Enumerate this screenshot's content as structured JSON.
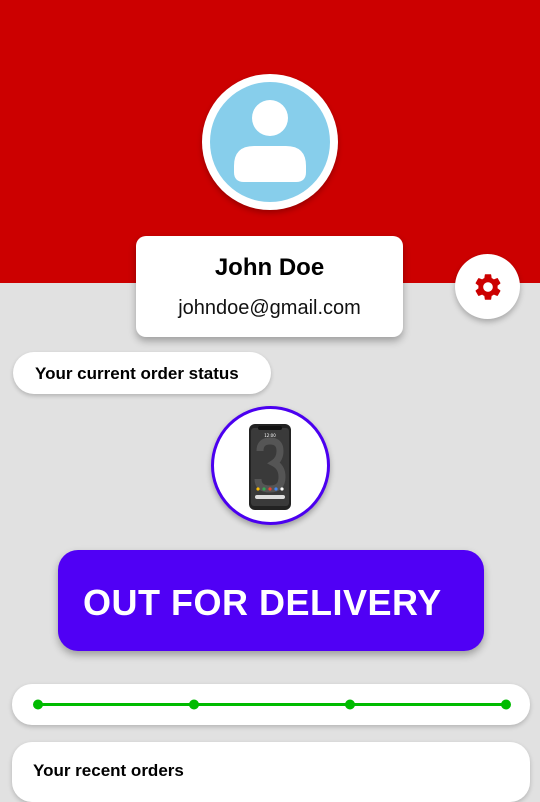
{
  "profile": {
    "name": "John Doe",
    "email": "johndoe@gmail.com",
    "avatar_icon": "user-avatar-icon"
  },
  "settings": {
    "icon": "gear-icon"
  },
  "order_status": {
    "label": "Your current order status",
    "product_image": "phone-image",
    "status_text": "OUT FOR DELIVERY",
    "progress": {
      "steps_total": 4,
      "steps_completed": 4,
      "fraction": 1.0
    }
  },
  "recent_orders": {
    "title": "Your recent orders"
  },
  "colors": {
    "header": "#cc0000",
    "background": "#e1e1e1",
    "accent": "#5000f5",
    "progress": "#00bb00",
    "avatar": "#87ceeb"
  }
}
